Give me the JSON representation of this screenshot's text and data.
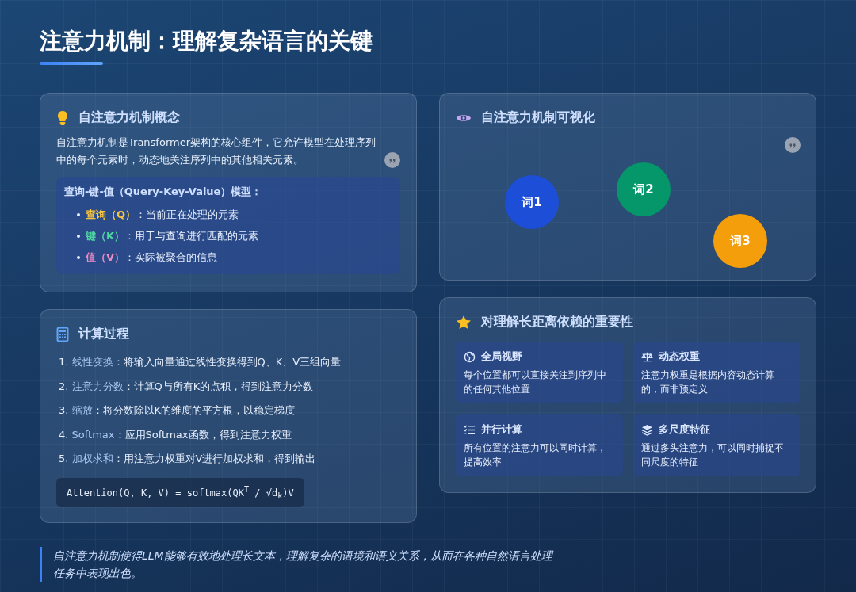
{
  "title": "注意力机制：理解复杂语言的关键",
  "concept": {
    "heading": "自注意力机制概念",
    "paragraph": "自注意力机制是Transformer架构的核心组件，它允许模型在处理序列中的每个元素时，动态地关注序列中的其他相关元素。",
    "qkv_title": "查询-键-值（Query-Key-Value）模型：",
    "qkv_items": [
      {
        "term": "查询（Q）",
        "text": "：当前正在处理的元素",
        "color": "#f5c542"
      },
      {
        "term": "键（K）",
        "text": "：用于与查询进行匹配的元素",
        "color": "#4fd6a0"
      },
      {
        "term": "值（V）",
        "text": "：实际被聚合的信息",
        "color": "#f08cc4"
      }
    ]
  },
  "visualization": {
    "heading": "自注意力机制可视化",
    "words": [
      {
        "label": "词1",
        "color": "#1d4ed8"
      },
      {
        "label": "词2",
        "color": "#059669"
      },
      {
        "label": "词3",
        "color": "#f59e0b"
      }
    ]
  },
  "computation": {
    "heading": "计算过程",
    "steps": [
      {
        "number": "1.",
        "term": "线性变换",
        "text": "：将输入向量通过线性变换得到Q、K、V三组向量"
      },
      {
        "number": "2.",
        "term": "注意力分数",
        "text": "：计算Q与所有K的点积，得到注意力分数"
      },
      {
        "number": "3.",
        "term": "缩放",
        "text": "：将分数除以K的维度的平方根，以稳定梯度"
      },
      {
        "number": "4.",
        "term": "Softmax",
        "text": "：应用Softmax函数，得到注意力权重"
      },
      {
        "number": "5.",
        "term": "加权求和",
        "text": "：用注意力权重对V进行加权求和，得到输出"
      }
    ],
    "formula": "Attention(Q, K, V) = softmax(QK$^{T}$ / √d$_{k}$)V"
  },
  "importance": {
    "heading": "对理解长距离依赖的重要性",
    "tiles": [
      {
        "kind": "globe",
        "title": "全局视野",
        "text": "每个位置都可以直接关注到序列中的任何其他位置"
      },
      {
        "kind": "scale",
        "title": "动态权重",
        "text": "注意力权重是根据内容动态计算的，而非预定义"
      },
      {
        "kind": "list",
        "title": "并行计算",
        "text": "所有位置的注意力可以同时计算，提高效率"
      },
      {
        "kind": "layers",
        "title": "多尺度特征",
        "text": "通过多头注意力，可以同时捕捉不同尺度的特征"
      }
    ]
  },
  "footer_quote": "自注意力机制使得LLM能够有效地处理长文本，理解复杂的语境和语义关系，从而在各种自然语言处理任务中表现出色。"
}
